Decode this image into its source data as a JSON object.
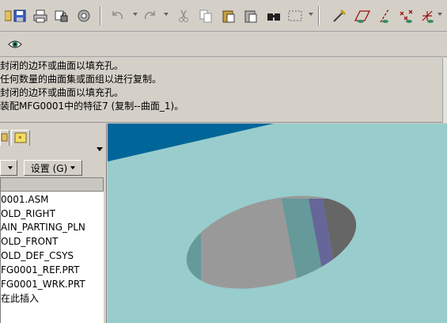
{
  "toolbar": {
    "icons": [
      "save-icon",
      "print-icon",
      "lock-icon",
      "settings-icon",
      "undo-icon",
      "redo-icon",
      "cut-icon",
      "copy-icon",
      "paste-icon",
      "paste-special-icon",
      "find-icon",
      "select-box-icon",
      "sketch-icon",
      "plane-icon",
      "axis-icon",
      "point-icon",
      "csys-icon"
    ]
  },
  "messages": [
    "封闭的边环或曲面以填充孔。",
    "任何数量的曲面集或面组以进行复制。",
    "封闭的边环或曲面以填充孔。",
    "装配MFG0001中的特征7 (复制--曲面_1)。"
  ],
  "panel": {
    "show_button": "",
    "settings_button": "设置 (G)",
    "tree_items": [
      "0001.ASM",
      "OLD_RIGHT",
      "AIN_PARTING_PLN",
      "OLD_FRONT",
      "OLD_DEF_CSYS",
      "FG0001_REF.PRT",
      "FG0001_WRK.PRT",
      "在此插入"
    ]
  },
  "colors": {
    "background": "#d4d0c8",
    "viewport": "#99cccc",
    "surface": "#999999",
    "highlight_blue": "#006699"
  }
}
